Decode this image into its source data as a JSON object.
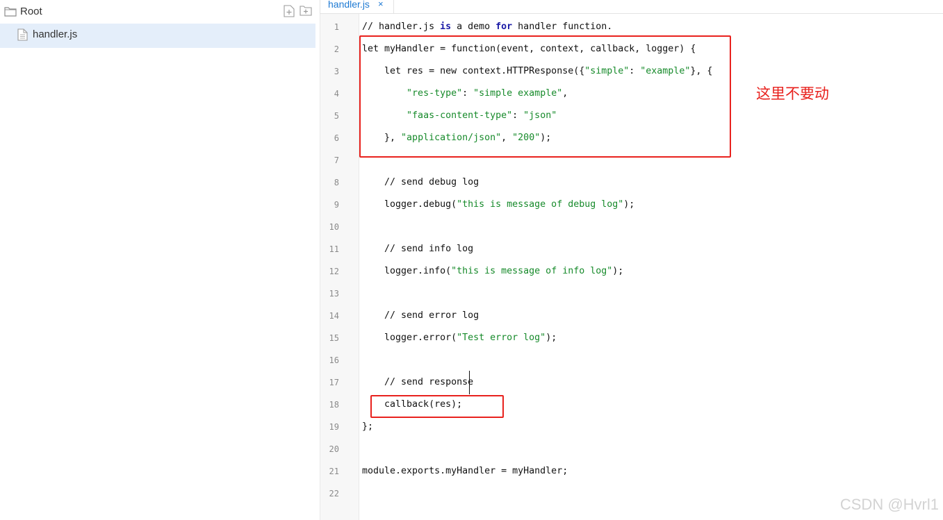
{
  "sidebar": {
    "root_label": "Root",
    "icons": [
      "folder-icon",
      "new-file-icon",
      "new-folder-icon",
      "file-icon"
    ],
    "files": [
      {
        "name": "handler.js",
        "selected": true
      }
    ]
  },
  "editor": {
    "tab": {
      "label": "handler.js",
      "close": "×"
    },
    "line_numbers": [
      "1",
      "2",
      "3",
      "4",
      "5",
      "6",
      "7",
      "8",
      "9",
      "10",
      "11",
      "12",
      "13",
      "14",
      "15",
      "16",
      "17",
      "18",
      "19",
      "20",
      "21",
      "22"
    ]
  },
  "code": {
    "line1": {
      "c1": "// handler.js ",
      "k1": "is",
      "c2": " a demo ",
      "k2": "for",
      "c3": " handler function."
    },
    "line2": "let myHandler = function(event, context, callback, logger) {",
    "line3": {
      "a": "    let res = new context.HTTPResponse({",
      "s1": "\"simple\"",
      "b": ": ",
      "s2": "\"example\"",
      "c": "}, {"
    },
    "line4": {
      "a": "        ",
      "s1": "\"res-type\"",
      "b": ": ",
      "s2": "\"simple example\"",
      "c": ","
    },
    "line5": {
      "a": "        ",
      "s1": "\"faas-content-type\"",
      "b": ": ",
      "s2": "\"json\""
    },
    "line6": {
      "a": "    }, ",
      "s1": "\"application/json\"",
      "b": ", ",
      "s2": "\"200\"",
      "c": ");"
    },
    "line8": "    // send debug log",
    "line9": {
      "a": "    logger.debug(",
      "s": "\"this is message of debug log\"",
      "b": ");"
    },
    "line11": "    // send info log",
    "line12": {
      "a": "    logger.info(",
      "s": "\"this is message of info log\"",
      "b": ");"
    },
    "line14": "    // send error log",
    "line15": {
      "a": "    logger.error(",
      "s": "\"Test error log\"",
      "b": ");"
    },
    "line17": "    // send response",
    "line18": "    callback(res);",
    "line19": "};",
    "line21": "module.exports.myHandler = myHandler;"
  },
  "annotation": {
    "note": "这里不要动",
    "color": "#e8211d"
  },
  "watermark": "CSDN @Hvrl1",
  "colors": {
    "keyword": "#1a1aa6",
    "string": "#168a2a",
    "tab_text": "#1e7ad3",
    "selected_row": "#e4eefa"
  }
}
